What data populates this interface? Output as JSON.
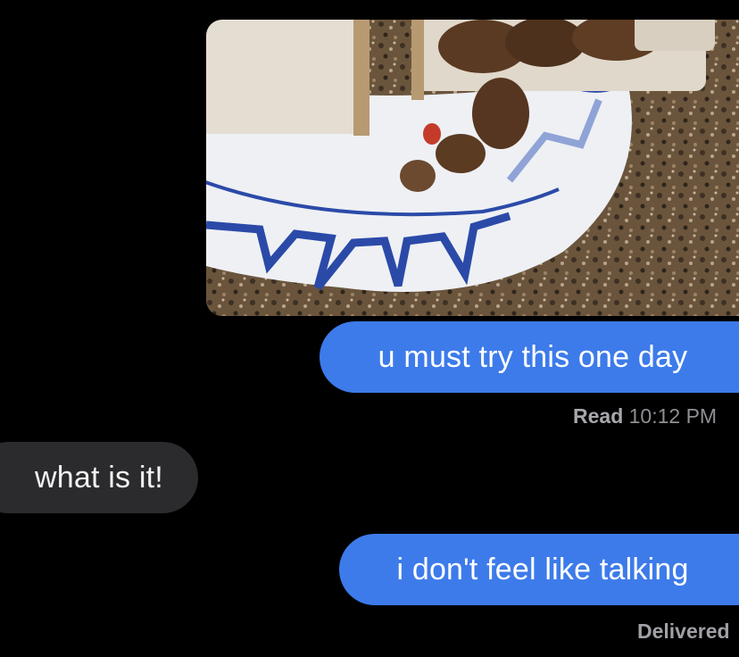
{
  "conversation": {
    "photo": {
      "description_icon": "image-attachment",
      "colors": {
        "bread": "#e4ddd2",
        "crust": "#b79a72",
        "plate": "#eef0f4",
        "plate_blue": "#2b4aa8",
        "counter": "#5e4a34",
        "meat": "#5a3a22",
        "ketchup": "#c43b2a"
      }
    },
    "messages": [
      {
        "sender": "me",
        "text": "u must try this one day"
      },
      {
        "sender": "them",
        "text": "what is it!"
      },
      {
        "sender": "me",
        "text": "i don't feel like talking"
      }
    ],
    "read_receipt": {
      "label": "Read",
      "time": "10:12 PM"
    },
    "delivered_receipt": "Delivered"
  }
}
